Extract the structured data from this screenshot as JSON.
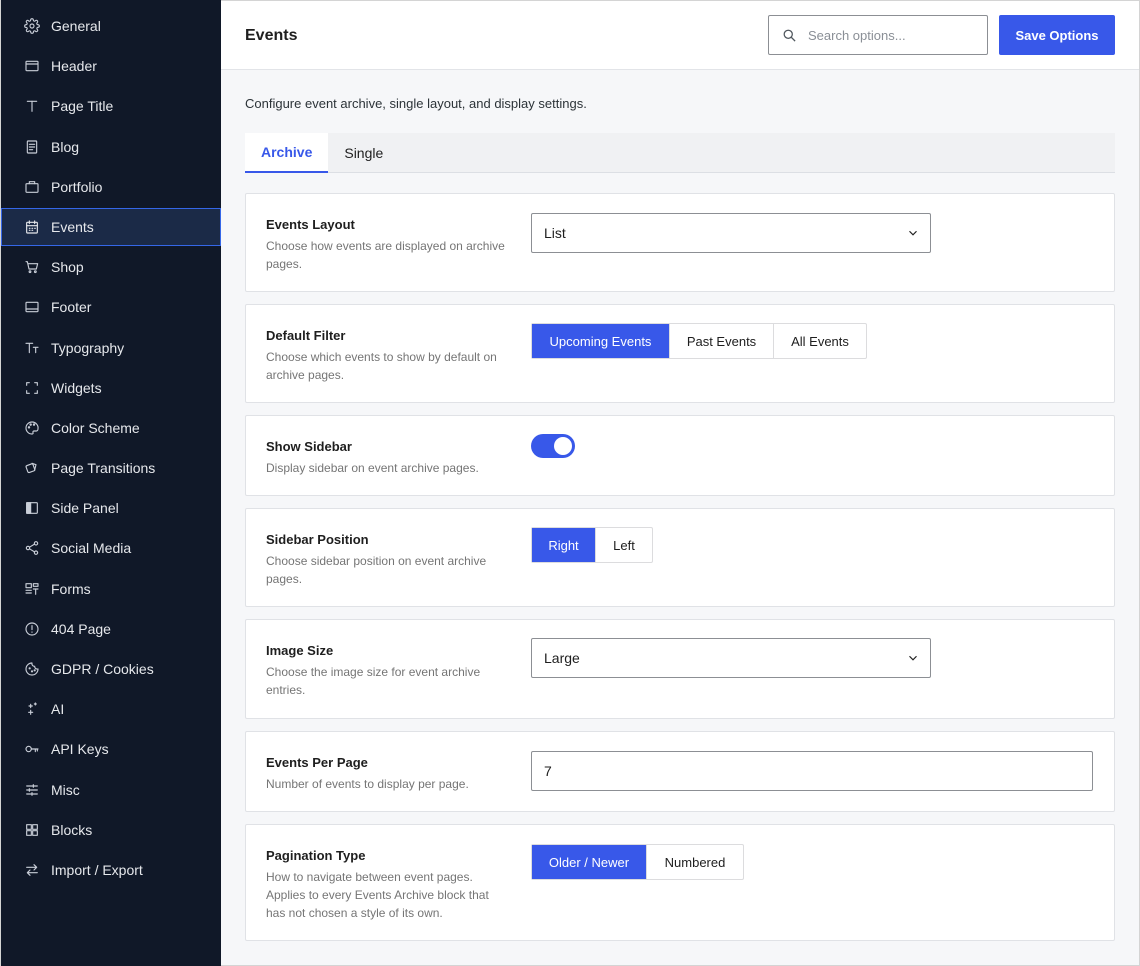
{
  "sidebar": {
    "items": [
      {
        "label": "General",
        "icon": "gear-icon"
      },
      {
        "label": "Header",
        "icon": "header-icon"
      },
      {
        "label": "Page Title",
        "icon": "title-t-icon"
      },
      {
        "label": "Blog",
        "icon": "blog-document-icon"
      },
      {
        "label": "Portfolio",
        "icon": "briefcase-icon"
      },
      {
        "label": "Events",
        "icon": "calendar-icon",
        "active": true
      },
      {
        "label": "Shop",
        "icon": "cart-icon"
      },
      {
        "label": "Footer",
        "icon": "footer-icon"
      },
      {
        "label": "Typography",
        "icon": "typography-icon"
      },
      {
        "label": "Widgets",
        "icon": "widgets-icon"
      },
      {
        "label": "Color Scheme",
        "icon": "palette-icon"
      },
      {
        "label": "Page Transitions",
        "icon": "transitions-icon"
      },
      {
        "label": "Side Panel",
        "icon": "side-panel-icon"
      },
      {
        "label": "Social Media",
        "icon": "share-icon"
      },
      {
        "label": "Forms",
        "icon": "forms-icon"
      },
      {
        "label": "404 Page",
        "icon": "alert-circle-icon"
      },
      {
        "label": "GDPR / Cookies",
        "icon": "cookie-icon"
      },
      {
        "label": "AI",
        "icon": "sparkles-icon"
      },
      {
        "label": "API Keys",
        "icon": "key-icon"
      },
      {
        "label": "Misc",
        "icon": "sliders-icon"
      },
      {
        "label": "Blocks",
        "icon": "blocks-icon"
      },
      {
        "label": "Import / Export",
        "icon": "swap-arrows-icon"
      }
    ]
  },
  "header": {
    "title": "Events",
    "search_placeholder": "Search options...",
    "save_label": "Save Options"
  },
  "main": {
    "description": "Configure event archive, single layout, and display settings.",
    "tabs": [
      {
        "label": "Archive",
        "active": true
      },
      {
        "label": "Single",
        "active": false
      }
    ],
    "settings": {
      "events_layout": {
        "label": "Events Layout",
        "help": "Choose how events are displayed on archive pages.",
        "value": "List"
      },
      "default_filter": {
        "label": "Default Filter",
        "help": "Choose which events to show by default on archive pages.",
        "options": [
          "Upcoming Events",
          "Past Events",
          "All Events"
        ],
        "selected": "Upcoming Events"
      },
      "show_sidebar": {
        "label": "Show Sidebar",
        "help": "Display sidebar on event archive pages.",
        "enabled": true
      },
      "sidebar_position": {
        "label": "Sidebar Position",
        "help": "Choose sidebar position on event archive pages.",
        "options": [
          "Right",
          "Left"
        ],
        "selected": "Right"
      },
      "image_size": {
        "label": "Image Size",
        "help": "Choose the image size for event archive entries.",
        "value": "Large"
      },
      "events_per_page": {
        "label": "Events Per Page",
        "help": "Number of events to display per page.",
        "value": "7"
      },
      "pagination_type": {
        "label": "Pagination Type",
        "help": "How to navigate between event pages. Applies to every Events Archive block that has not chosen a style of its own.",
        "options": [
          "Older / Newer",
          "Numbered"
        ],
        "selected": "Older / Newer"
      }
    }
  },
  "colors": {
    "sidebar_bg": "#101828",
    "accent": "#3858e9",
    "page_bg": "#f6f7f9"
  }
}
